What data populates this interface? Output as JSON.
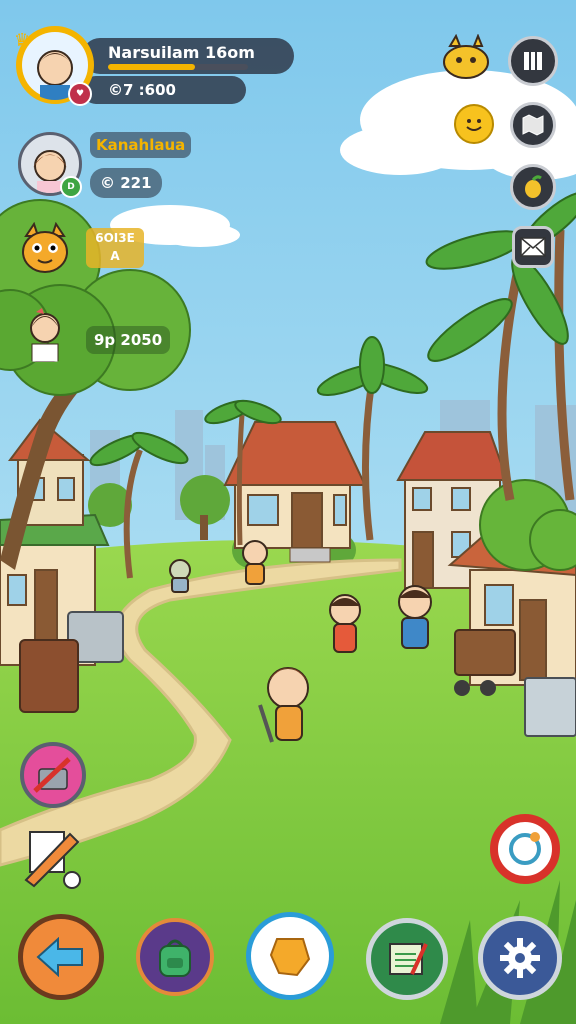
{
  "player": {
    "name": "Narsuilam 16om",
    "coins": "©7 :600",
    "xp_fill": 0.62
  },
  "friends": [
    {
      "name": "Kanahlaua",
      "score": "© 221"
    },
    {
      "label_line1": "6OI3E",
      "label_line2": "A"
    },
    {
      "score": "9p 2050"
    }
  ],
  "colors": {
    "accent_gold": "#f4b400",
    "pill_bg": "#2c2f3c",
    "settings_blue": "#3b5998",
    "grass": "#8ccf47"
  },
  "icons": {
    "pause": "pause-icon",
    "mascot": "cat-mascot-icon",
    "emote": "smiley-emote-icon",
    "map": "map-icon",
    "fruit": "fruit-icon",
    "mail": "mail-icon",
    "back": "back-arrow-icon",
    "backpack": "backpack-icon",
    "chat": "chat-bubble-icon",
    "quest": "quest-scroll-icon",
    "settings": "gear-icon",
    "lifebuoy": "lifebuoy-icon",
    "shop": "shop-icon",
    "build": "build-tool-icon"
  }
}
